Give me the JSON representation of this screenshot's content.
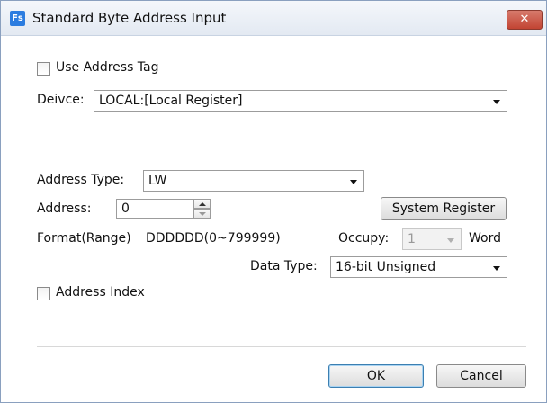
{
  "window": {
    "title": "Standard Byte Address Input",
    "icon": "Fs",
    "close_symbol": "✕"
  },
  "use_address_tag": {
    "label": "Use Address Tag",
    "checked": false
  },
  "device": {
    "label": "Deivce:",
    "value": "LOCAL:[Local Register]"
  },
  "address_type": {
    "label": "Address Type:",
    "value": "LW"
  },
  "address": {
    "label": "Address:",
    "value": "0"
  },
  "system_register_button": "System Register",
  "format": {
    "label": "Format(Range)",
    "value": "DDDDDD(0~799999)"
  },
  "occupy": {
    "label": "Occupy:",
    "value": "1",
    "unit": "Word"
  },
  "data_type": {
    "label": "Data Type:",
    "value": "16-bit Unsigned"
  },
  "address_index": {
    "label": "Address Index",
    "checked": false
  },
  "buttons": {
    "ok": "OK",
    "cancel": "Cancel"
  }
}
